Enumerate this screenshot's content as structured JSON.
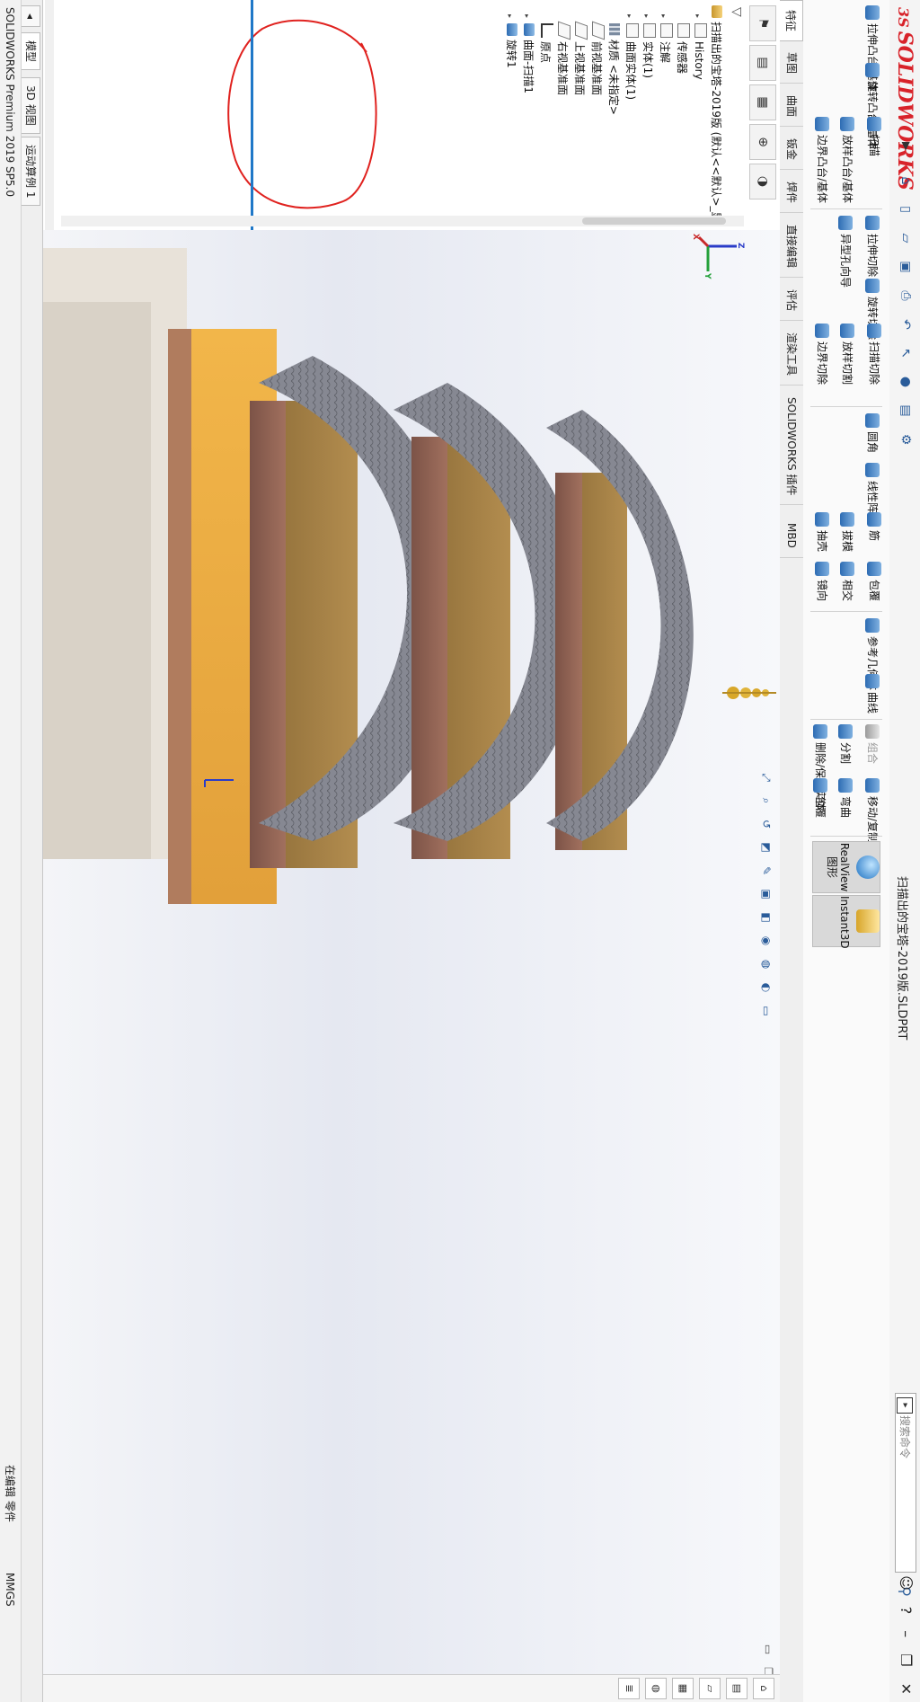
{
  "app": {
    "logo_text": "SOLIDWORKS",
    "logo_prefix": "3S",
    "document_title": "扫描出的宝塔-2019版.SLDPRT",
    "search_placeholder": "搜索命令"
  },
  "command_manager": {
    "features": [
      {
        "label": "拉伸凸台/基体"
      },
      {
        "label": "旋转凸台/基体"
      },
      {
        "label": "扫描"
      },
      {
        "label": "放样凸台/基体"
      },
      {
        "label": "边界凸台/基体"
      },
      {
        "label": "拉伸切除"
      },
      {
        "label": "异型孔向导"
      },
      {
        "label": "旋转切除"
      },
      {
        "label": "扫描切除"
      },
      {
        "label": "放样切割"
      },
      {
        "label": "边界切除"
      },
      {
        "label": "圆角"
      },
      {
        "label": "线性阵列"
      },
      {
        "label": "筋"
      },
      {
        "label": "拔模"
      },
      {
        "label": "抽壳"
      },
      {
        "label": "包覆"
      },
      {
        "label": "相交"
      },
      {
        "label": "镜向"
      },
      {
        "label": "参考几何体"
      },
      {
        "label": "曲线"
      },
      {
        "label": "组合"
      },
      {
        "label": "分割"
      },
      {
        "label": "删除/保留实体"
      },
      {
        "label": "移动/复制实体"
      },
      {
        "label": "弯曲"
      },
      {
        "label": "包覆"
      },
      {
        "label": "RealView 图形"
      },
      {
        "label": "Instant3D"
      }
    ]
  },
  "tabs": [
    "特征",
    "草图",
    "曲面",
    "钣金",
    "焊件",
    "直接编辑",
    "评估",
    "渲染工具",
    "SOLIDWORKS 插件",
    "MBD"
  ],
  "feature_tree": {
    "root": "扫描出的宝塔-2019版 (默认<<默认>_显",
    "items": [
      {
        "label": "History",
        "type": "folder"
      },
      {
        "label": "传感器",
        "type": "folder"
      },
      {
        "label": "注解",
        "type": "folder"
      },
      {
        "label": "实体(1)",
        "type": "folder"
      },
      {
        "label": "曲面实体(1)",
        "type": "folder"
      },
      {
        "label": "材质 <未指定>",
        "type": "material"
      },
      {
        "label": "前视基准面",
        "type": "plane"
      },
      {
        "label": "上视基准面",
        "type": "plane"
      },
      {
        "label": "右视基准面",
        "type": "plane"
      },
      {
        "label": "原点",
        "type": "origin"
      },
      {
        "label": "曲面-扫描1",
        "type": "feature"
      },
      {
        "label": "旋转1",
        "type": "feature"
      }
    ]
  },
  "model_tabs": [
    "模型",
    "3D 视图",
    "运动算例 1"
  ],
  "status": {
    "left": "SOLIDWORKS Premium 2019 SP5.0",
    "middle": "在编辑 零件",
    "right": "MMGS"
  },
  "colors": {
    "accent": "#1f78c8",
    "brand_red": "#d8232a",
    "annotation_red": "#e0221f"
  }
}
